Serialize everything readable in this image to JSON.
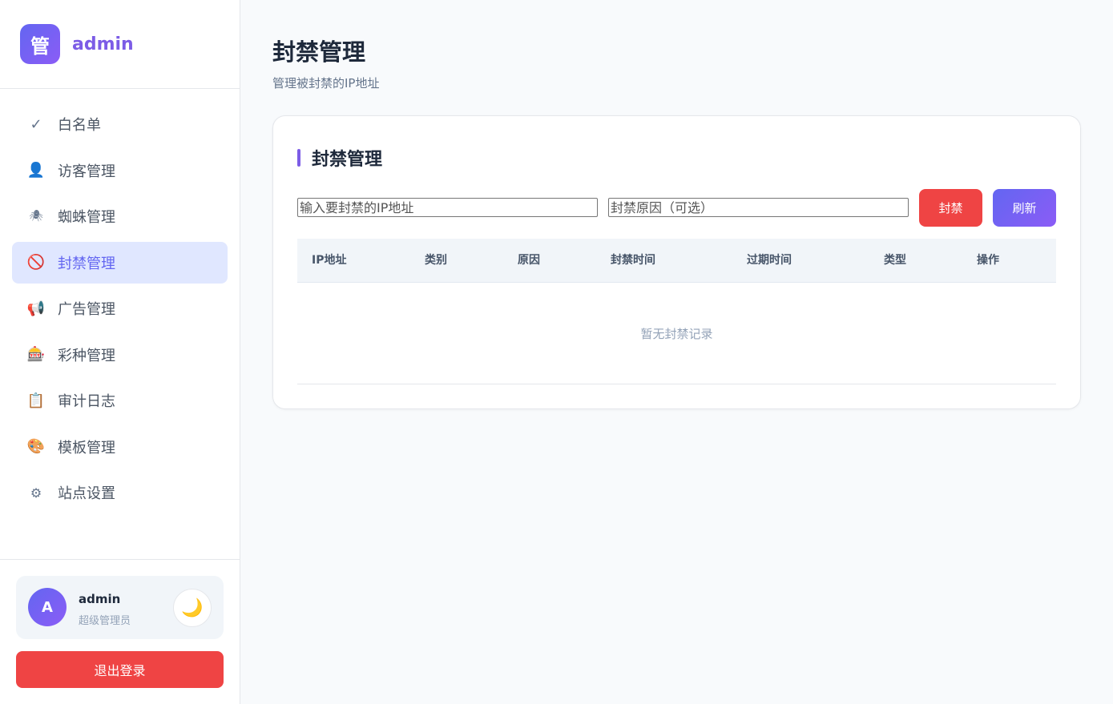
{
  "brand": {
    "logo_char": "管",
    "name": "admin"
  },
  "sidebar": {
    "items": [
      {
        "icon": "✓",
        "icon_name": "check-icon",
        "label": "白名单"
      },
      {
        "icon": "👤",
        "icon_name": "visitor-icon",
        "label": "访客管理"
      },
      {
        "icon": "🕷",
        "icon_name": "spider-icon",
        "label": "蜘蛛管理"
      },
      {
        "icon": "🚫",
        "icon_name": "ban-icon",
        "label": "封禁管理"
      },
      {
        "icon": "📢",
        "icon_name": "megaphone-icon",
        "label": "广告管理"
      },
      {
        "icon": "🎰",
        "icon_name": "slot-machine-icon",
        "label": "彩种管理"
      },
      {
        "icon": "📋",
        "icon_name": "clipboard-icon",
        "label": "审计日志"
      },
      {
        "icon": "🎨",
        "icon_name": "palette-icon",
        "label": "模板管理"
      },
      {
        "icon": "⚙",
        "icon_name": "gear-icon",
        "label": "站点设置"
      }
    ],
    "active_index": 3
  },
  "user": {
    "avatar_letter": "A",
    "name": "admin",
    "role": "超级管理员",
    "theme_icon": "🌙"
  },
  "logout_label": "退出登录",
  "page": {
    "title": "封禁管理",
    "subtitle": "管理被封禁的IP地址"
  },
  "card": {
    "title": "封禁管理",
    "ip_placeholder": "输入要封禁的IP地址",
    "ip_value": "",
    "reason_placeholder": "封禁原因（可选）",
    "reason_value": "",
    "ban_label": "封禁",
    "refresh_label": "刷新"
  },
  "table": {
    "columns": [
      "IP地址",
      "类别",
      "原因",
      "封禁时间",
      "过期时间",
      "类型",
      "操作"
    ],
    "rows": [],
    "empty_text": "暂无封禁记录"
  },
  "colors": {
    "accent": "#7c5ce6",
    "danger": "#ef4444",
    "active_bg": "#e0e7ff"
  }
}
